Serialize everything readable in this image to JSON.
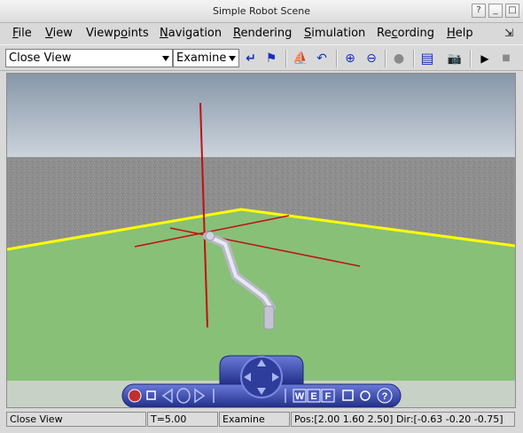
{
  "window": {
    "title": "Simple Robot Scene",
    "buttons": {
      "help": "?",
      "minimize": "_",
      "maximize": "□"
    },
    "shortcut_glyph": "⇲"
  },
  "menu": [
    {
      "label": "File",
      "mnemonic": "F",
      "rest": "ile"
    },
    {
      "label": "View",
      "mnemonic": "V",
      "rest": "iew"
    },
    {
      "label": "Viewpoints",
      "before": "Viewp",
      "mnemonic": "o",
      "rest": "ints"
    },
    {
      "label": "Navigation",
      "mnemonic": "N",
      "rest": "avigation"
    },
    {
      "label": "Rendering",
      "mnemonic": "R",
      "rest": "endering"
    },
    {
      "label": "Simulation",
      "mnemonic": "S",
      "rest": "imulation"
    },
    {
      "label": "Recording",
      "before": "Re",
      "mnemonic": "c",
      "rest": "ording"
    },
    {
      "label": "Help",
      "mnemonic": "H",
      "rest": "elp"
    }
  ],
  "toolbar": {
    "viewpoint_select": "Close View",
    "nav_mode_select": "Examine",
    "icons": {
      "return": "↵",
      "flag": "⚑",
      "straighten": "⛵",
      "undo": "↶",
      "zoom_in": "⊕",
      "zoom_out": "⊖",
      "record": "●",
      "document": "▤",
      "camera": "📷",
      "play": "▶",
      "stop": "■"
    }
  },
  "colors": {
    "sky_top": "#8797a8",
    "sky_bottom": "#cdd5dd",
    "wall": "#8e8e8e",
    "floor": "#88c078",
    "floor_border": "#ffff00",
    "axes": "#c01010",
    "dashboard": "#3b4aa8",
    "robot": "#c8c8d4"
  },
  "dashboard": {
    "w_label": "W",
    "e_label": "E",
    "f_label": "F",
    "help_label": "?"
  },
  "status": {
    "viewpoint": "Close View",
    "time": "T=5.00",
    "mode": "Examine",
    "pos_dir": "Pos:[2.00 1.60 2.50] Dir:[-0.63 -0.20 -0.75]"
  }
}
